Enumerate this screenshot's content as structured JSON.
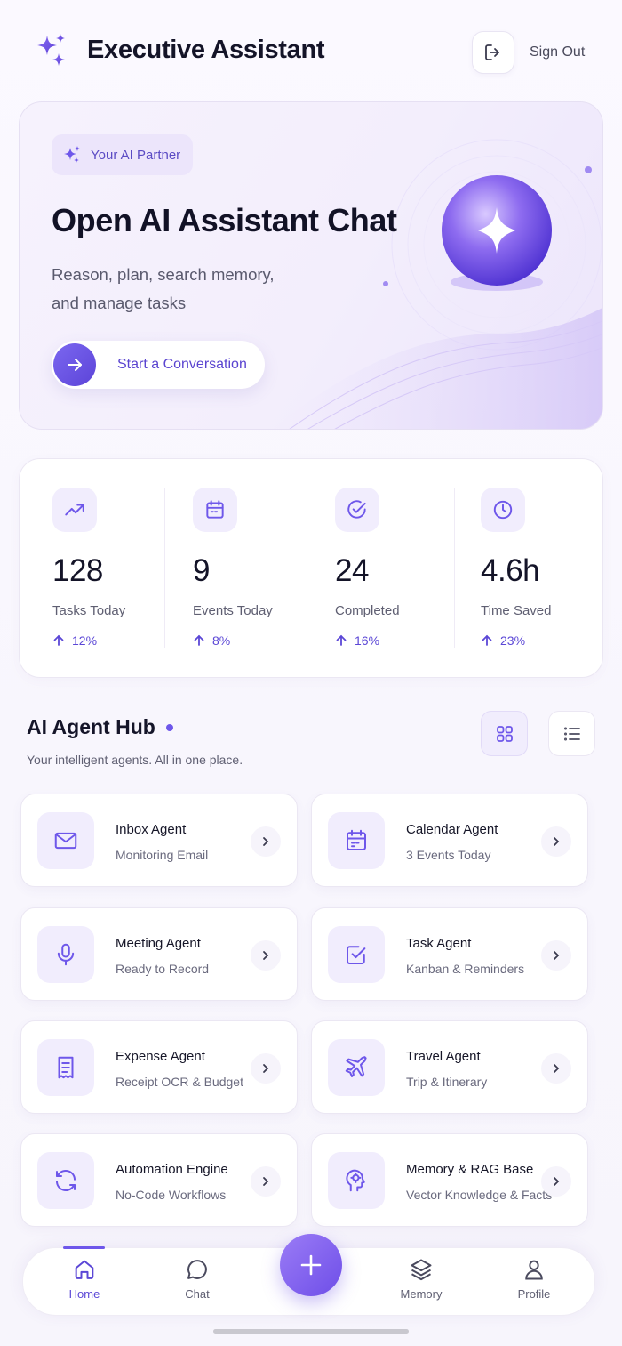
{
  "header": {
    "title": "Executive Assistant",
    "sign_out_label": "Sign Out"
  },
  "hero": {
    "badge": "Your AI Partner",
    "title": "Open AI Assistant Chat",
    "subtitle": "Reason, plan, search memory, and manage tasks",
    "cta_label": "Start a Conversation"
  },
  "stats": [
    {
      "value": "128",
      "label": "Tasks Today",
      "delta": "12%",
      "icon": "trending-up-icon"
    },
    {
      "value": "9",
      "label": "Events Today",
      "delta": "8%",
      "icon": "calendar-icon"
    },
    {
      "value": "24",
      "label": "Completed",
      "delta": "16%",
      "icon": "check-circle-icon"
    },
    {
      "value": "4.6h",
      "label": "Time Saved",
      "delta": "23%",
      "icon": "clock-icon"
    }
  ],
  "hub": {
    "title": "AI Agent Hub",
    "subtitle": "Your intelligent agents. All in one place.",
    "view_mode": "grid"
  },
  "agents": [
    {
      "title": "Inbox Agent",
      "subtitle": "Monitoring Email",
      "icon": "mail-icon"
    },
    {
      "title": "Calendar Agent",
      "subtitle": "3 Events Today",
      "icon": "calendar-icon"
    },
    {
      "title": "Meeting Agent",
      "subtitle": "Ready to Record",
      "icon": "microphone-icon"
    },
    {
      "title": "Task Agent",
      "subtitle": "Kanban & Reminders",
      "icon": "checkbox-icon"
    },
    {
      "title": "Expense Agent",
      "subtitle": "Receipt OCR & Budget",
      "icon": "receipt-icon"
    },
    {
      "title": "Travel Agent",
      "subtitle": "Trip & Itinerary",
      "icon": "airplane-icon"
    },
    {
      "title": "Automation Engine",
      "subtitle": "No-Code Workflows",
      "icon": "refresh-icon"
    },
    {
      "title": "Memory & RAG Base",
      "subtitle": "Vector Knowledge & Facts",
      "icon": "brain-head-icon"
    }
  ],
  "nav": {
    "items": [
      {
        "label": "Home",
        "icon": "home-icon",
        "active": true
      },
      {
        "label": "Chat",
        "icon": "chat-bubble-icon",
        "active": false
      },
      {
        "label": "Memory",
        "icon": "layers-icon",
        "active": false
      },
      {
        "label": "Profile",
        "icon": "user-icon",
        "active": false
      }
    ],
    "fab_icon": "plus-icon"
  },
  "colors": {
    "accent": "#6e57ea",
    "accent_dark": "#5b47d6",
    "icon_bg": "#f1edfd"
  }
}
